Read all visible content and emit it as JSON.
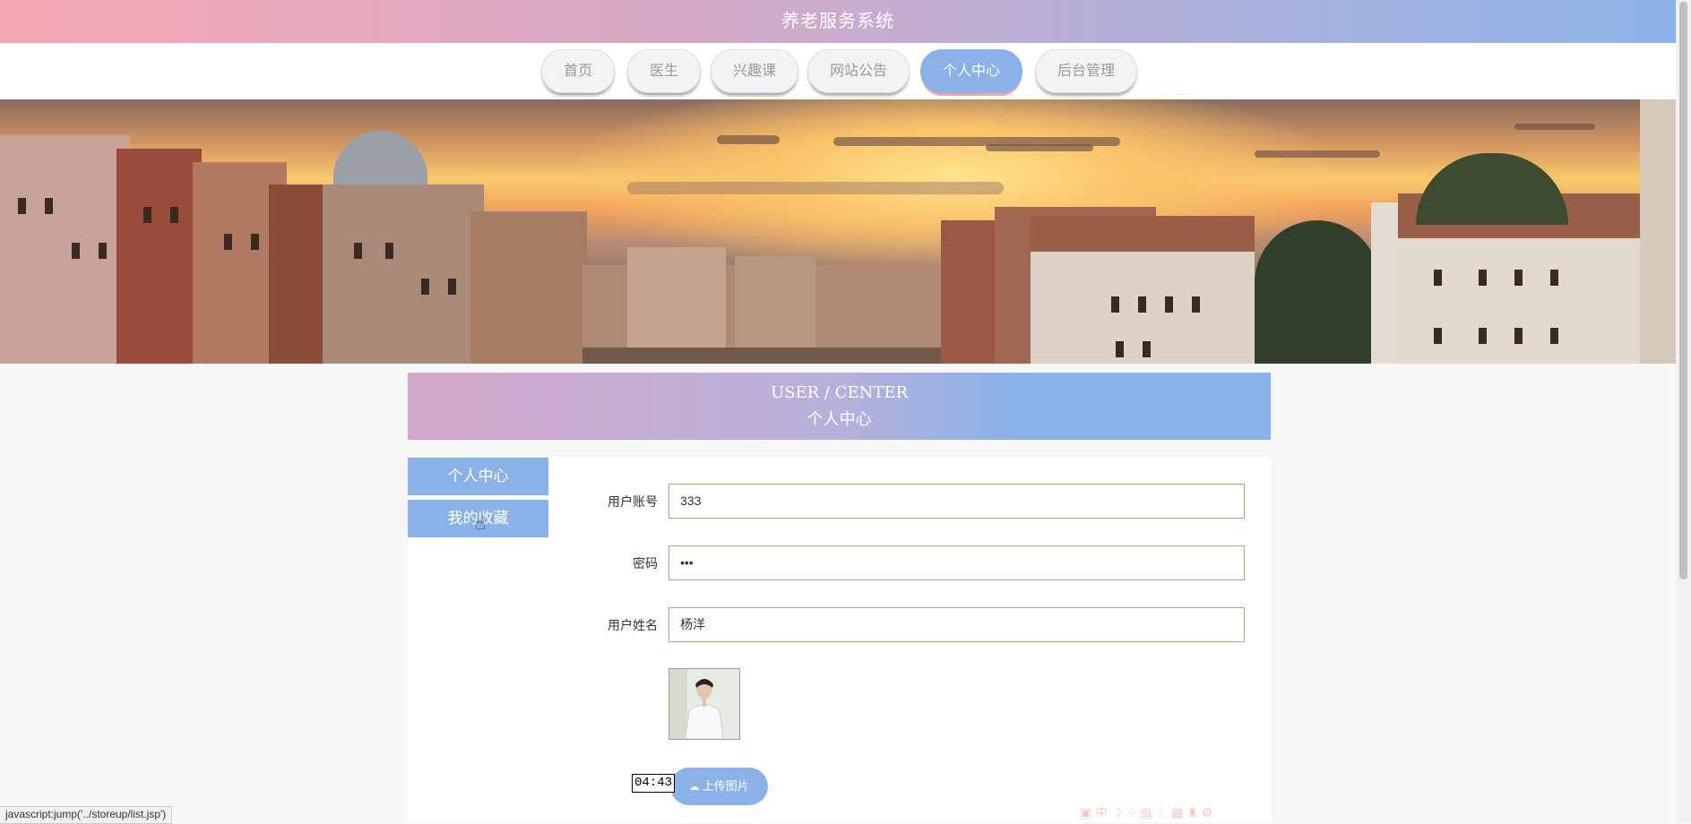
{
  "app": {
    "title": "养老服务系统"
  },
  "nav": [
    {
      "label": "首页"
    },
    {
      "label": "医生"
    },
    {
      "label": "兴趣课"
    },
    {
      "label": "网站公告"
    },
    {
      "label": "个人中心",
      "active": true
    },
    {
      "label": "后台管理"
    }
  ],
  "section": {
    "title_en": "USER / CENTER",
    "title_cn": "个人中心"
  },
  "sidebar": [
    {
      "label": "个人中心"
    },
    {
      "label": "我的收藏"
    }
  ],
  "form": {
    "account": {
      "label": "用户账号",
      "value": "333"
    },
    "password": {
      "label": "密码",
      "value": "•••"
    },
    "name": {
      "label": "用户姓名",
      "value": "杨洋"
    },
    "upload_label": "上传图片"
  },
  "tooltip": "04:43",
  "status_url": "javascript:jump('../storeup/list.jsp')",
  "colors": {
    "accent": "#8ab2e8",
    "pink": "#f5a5b0"
  }
}
